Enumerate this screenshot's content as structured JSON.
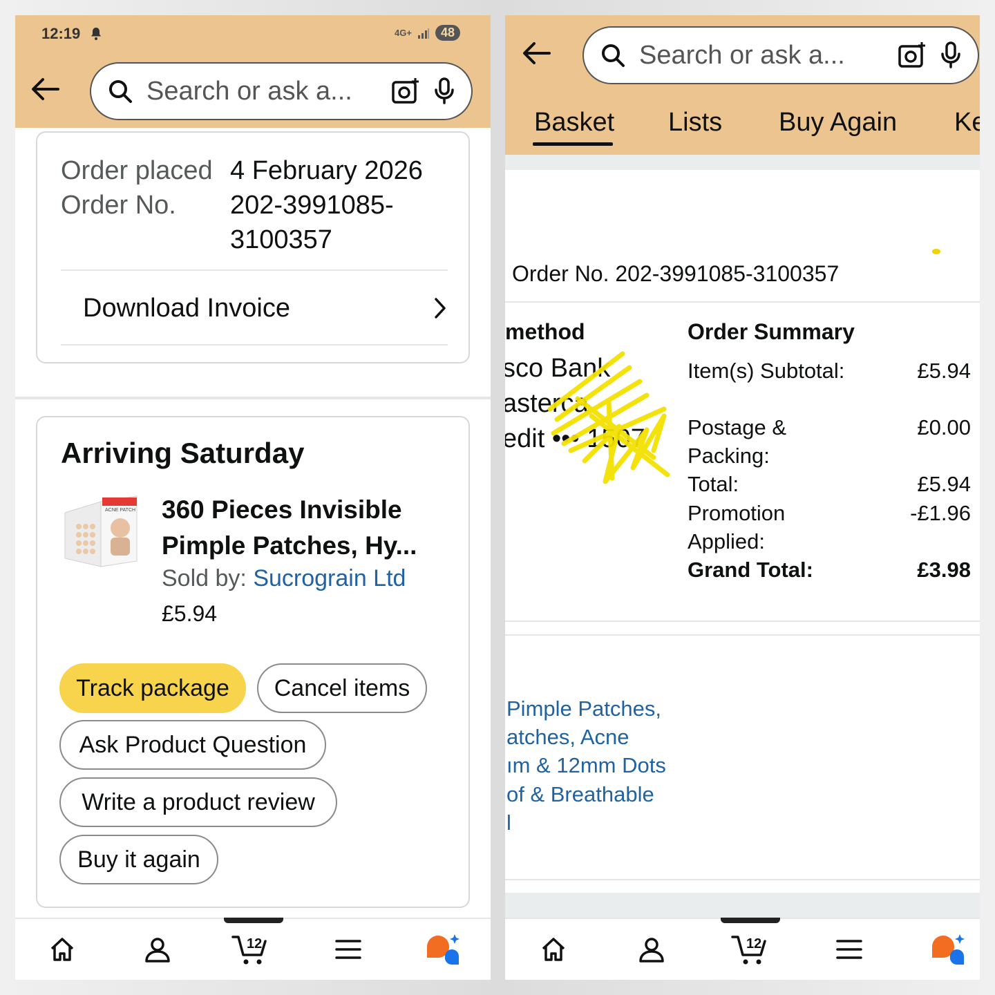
{
  "left": {
    "status": {
      "time": "12:19",
      "network": "4G+",
      "battery": "48"
    },
    "search": {
      "placeholder": "Search or ask a..."
    },
    "order": {
      "placed_label": "Order placed",
      "placed_value": "4 February 2026",
      "number_label": "Order No.",
      "number_value": "202-3991085-3100357",
      "download_invoice": "Download Invoice"
    },
    "shipment": {
      "heading": "Arriving Saturday",
      "product_title": "360 Pieces Invisible Pimple Patches, Hy...",
      "sold_by_label": "Sold by: ",
      "seller": "Sucrograin Ltd",
      "price": "£5.94",
      "thumb_label": "ACNE PATCH"
    },
    "actions": {
      "track": "Track package",
      "cancel": "Cancel items",
      "ask": "Ask Product Question",
      "review": "Write a product review",
      "buy_again": "Buy it again"
    },
    "nav": {
      "cart_count": "12"
    }
  },
  "right": {
    "search": {
      "placeholder": "Search or ask a..."
    },
    "tabs": [
      "Basket",
      "Lists",
      "Buy Again",
      "Ke"
    ],
    "order_no": "Order No. 202-3991085-3100357",
    "payment": {
      "heading": "method",
      "line1": "sco Bank",
      "line2": "asterca",
      "line3": "edit ••• 1507"
    },
    "summary": {
      "heading": "Order Summary",
      "rows": [
        {
          "label": "Item(s) Subtotal:",
          "value": "£5.94"
        },
        {
          "label": "Postage & Packing:",
          "value": "£0.00"
        },
        {
          "label": "Total:",
          "value": "£5.94"
        },
        {
          "label": "Promotion Applied:",
          "value": "-£1.96"
        },
        {
          "label": "Grand Total:",
          "value": "£3.98"
        }
      ]
    },
    "item_title_lines": [
      "Pimple Patches,",
      "atches, Acne",
      "ım & 12mm Dots",
      "of & Breathable",
      "l"
    ],
    "nav": {
      "cart_count": "12"
    }
  },
  "colors": {
    "header": "#ecc48f",
    "primary_button": "#f7d44c",
    "link": "#2162a1",
    "scribble": "#f3e000",
    "assistant_orange": "#f26d21",
    "assistant_blue": "#1a73e8"
  }
}
